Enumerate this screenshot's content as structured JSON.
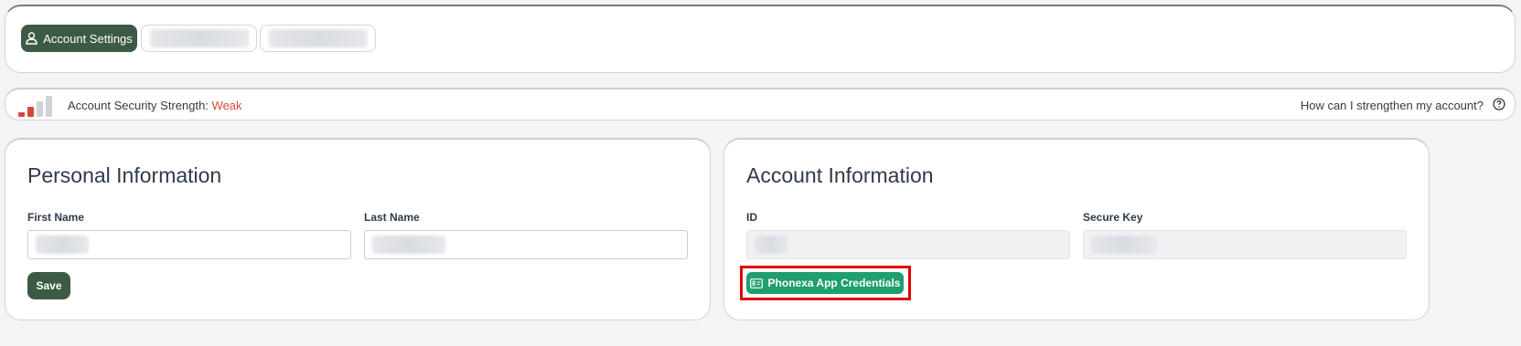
{
  "tabs": {
    "account_settings_label": "Account Settings",
    "active_color": "#3d5a45"
  },
  "security": {
    "label": "Account Security Strength:",
    "strength": "Weak",
    "strength_color": "#d9473b",
    "bars_filled": 2,
    "bars_total": 4,
    "help_link": "How can I strengthen my account?"
  },
  "personal": {
    "title": "Personal Information",
    "first_name_label": "First Name",
    "last_name_label": "Last Name",
    "save_label": "Save"
  },
  "account": {
    "title": "Account Information",
    "id_label": "ID",
    "secure_key_label": "Secure Key",
    "credentials_button": "Phonexa App Credentials",
    "credentials_color": "#1f9e6e"
  },
  "icons": [
    "user-icon",
    "help-circle-icon",
    "id-card-icon",
    "signal-bars-icon"
  ]
}
